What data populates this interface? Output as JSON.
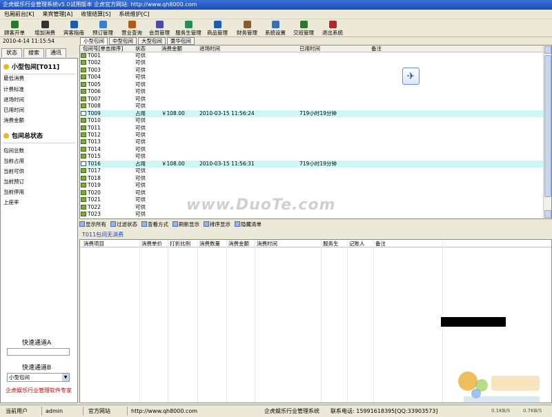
{
  "window": {
    "title": "企虎娱乐行业管理系统v5.0试用版本  企虎官方网站: http://www.qh8000.com"
  },
  "menu": {
    "items": [
      "包厢前台[K]",
      "来宾管理[A]",
      "收银结算[S]",
      "系统维护[C]"
    ]
  },
  "toolbar": {
    "buttons": [
      {
        "label": "顾客开单",
        "icon": "open-bill-icon",
        "color": "#2a7a2a"
      },
      {
        "label": "增加消费",
        "icon": "binoculars-icon",
        "color": "#333333"
      },
      {
        "label": "宾客指南",
        "icon": "speaker-icon",
        "color": "#1c5db0"
      },
      {
        "label": "预订管理",
        "icon": "booking-icon",
        "color": "#3a80c8"
      },
      {
        "label": "营业查询",
        "icon": "query-icon",
        "color": "#b05a1a"
      },
      {
        "label": "会员管理",
        "icon": "member-icon",
        "color": "#4a4aa8"
      },
      {
        "label": "服务生管理",
        "icon": "staff-icon",
        "color": "#2a8a5a"
      },
      {
        "label": "商品管理",
        "icon": "goods-icon",
        "color": "#1c5db0"
      },
      {
        "label": "财务管理",
        "icon": "finance-icon",
        "color": "#8a5a2a"
      },
      {
        "label": "系统设置",
        "icon": "settings-icon",
        "color": "#3a6fb0"
      },
      {
        "label": "交班管理",
        "icon": "shift-icon",
        "color": "#2a7a2a"
      },
      {
        "label": "退出系统",
        "icon": "exit-icon",
        "color": "#b02a2a"
      }
    ]
  },
  "datetime": "2010-4-14 11:15:54",
  "left_tabs": [
    "状态",
    "搜索",
    "通讯"
  ],
  "room_info": {
    "title": "小型包间[T011]",
    "items": [
      "最低消费",
      "计费标准",
      "进场时间",
      "已用时间",
      "消费金额"
    ]
  },
  "room_status": {
    "title": "包间总状态",
    "items": [
      "包间总数",
      "当前占用",
      "当前可供",
      "当前预订",
      "当前停用",
      "上座率"
    ]
  },
  "quick": {
    "a_label": "快速通道A",
    "b_label": "快速通道B",
    "b_value": "小型包间"
  },
  "brand": "企虎娱乐行业管理软件专家",
  "room_tabs": [
    "小型包间",
    "中型包间",
    "大型包间",
    "豪华包间"
  ],
  "grid": {
    "columns": [
      "包间号[单击排序]",
      "状态",
      "消费金额",
      "进场时间",
      "已用时间",
      "备注"
    ],
    "rows": [
      {
        "id": "T001",
        "status": "可供",
        "amount": "",
        "enter": "",
        "used": ""
      },
      {
        "id": "T002",
        "status": "可供",
        "amount": "",
        "enter": "",
        "used": ""
      },
      {
        "id": "T003",
        "status": "可供",
        "amount": "",
        "enter": "",
        "used": ""
      },
      {
        "id": "T004",
        "status": "可供",
        "amount": "",
        "enter": "",
        "used": ""
      },
      {
        "id": "T005",
        "status": "可供",
        "amount": "",
        "enter": "",
        "used": ""
      },
      {
        "id": "T006",
        "status": "可供",
        "amount": "",
        "enter": "",
        "used": ""
      },
      {
        "id": "T007",
        "status": "可供",
        "amount": "",
        "enter": "",
        "used": ""
      },
      {
        "id": "T008",
        "status": "可供",
        "amount": "",
        "enter": "",
        "used": ""
      },
      {
        "id": "T009",
        "status": "占用",
        "amount": "￥108.00",
        "enter": "2010-03-15 11:56:24",
        "used": "719小时19分钟"
      },
      {
        "id": "T010",
        "status": "可供",
        "amount": "",
        "enter": "",
        "used": ""
      },
      {
        "id": "T011",
        "status": "可供",
        "amount": "",
        "enter": "",
        "used": ""
      },
      {
        "id": "T012",
        "status": "可供",
        "amount": "",
        "enter": "",
        "used": ""
      },
      {
        "id": "T013",
        "status": "可供",
        "amount": "",
        "enter": "",
        "used": ""
      },
      {
        "id": "T014",
        "status": "可供",
        "amount": "",
        "enter": "",
        "used": ""
      },
      {
        "id": "T015",
        "status": "可供",
        "amount": "",
        "enter": "",
        "used": ""
      },
      {
        "id": "T016",
        "status": "占用",
        "amount": "￥108.00",
        "enter": "2010-03-15 11:56:31",
        "used": "719小时19分钟"
      },
      {
        "id": "T017",
        "status": "可供",
        "amount": "",
        "enter": "",
        "used": ""
      },
      {
        "id": "T018",
        "status": "可供",
        "amount": "",
        "enter": "",
        "used": ""
      },
      {
        "id": "T019",
        "status": "可供",
        "amount": "",
        "enter": "",
        "used": ""
      },
      {
        "id": "T020",
        "status": "可供",
        "amount": "",
        "enter": "",
        "used": ""
      },
      {
        "id": "T021",
        "status": "可供",
        "amount": "",
        "enter": "",
        "used": ""
      },
      {
        "id": "T022",
        "status": "可供",
        "amount": "",
        "enter": "",
        "used": ""
      },
      {
        "id": "T023",
        "status": "可供",
        "amount": "",
        "enter": "",
        "used": ""
      }
    ]
  },
  "actions": [
    "显示所有",
    "过滤状态",
    "查看方式",
    "刷新显示",
    "排序显示",
    "隐藏清单"
  ],
  "selected_room_status": "T011包间无消费",
  "detail": {
    "columns": [
      "消费项目",
      "消费单价",
      "打折比例",
      "消费数量",
      "消费金额",
      "消费时间",
      "服务生",
      "记账人",
      "备注"
    ]
  },
  "watermark": "www.DuoTe.com",
  "statusbar": {
    "user_label": "当前用户",
    "user": "admin",
    "site_label": "官方网站",
    "site": "http://www.qh8000.com",
    "app": "企虎娱乐行业管理系统",
    "contact": "联系电话: 15991618395[QQ:33903573]",
    "net_down": "0.1KB/S",
    "net_up": "0.7KB/S"
  },
  "colors": {
    "occupied_row": "#cdf6f6",
    "title_bar": "#1c4fb8",
    "brand": "#d40000",
    "status_link": "#1a3fb8"
  }
}
